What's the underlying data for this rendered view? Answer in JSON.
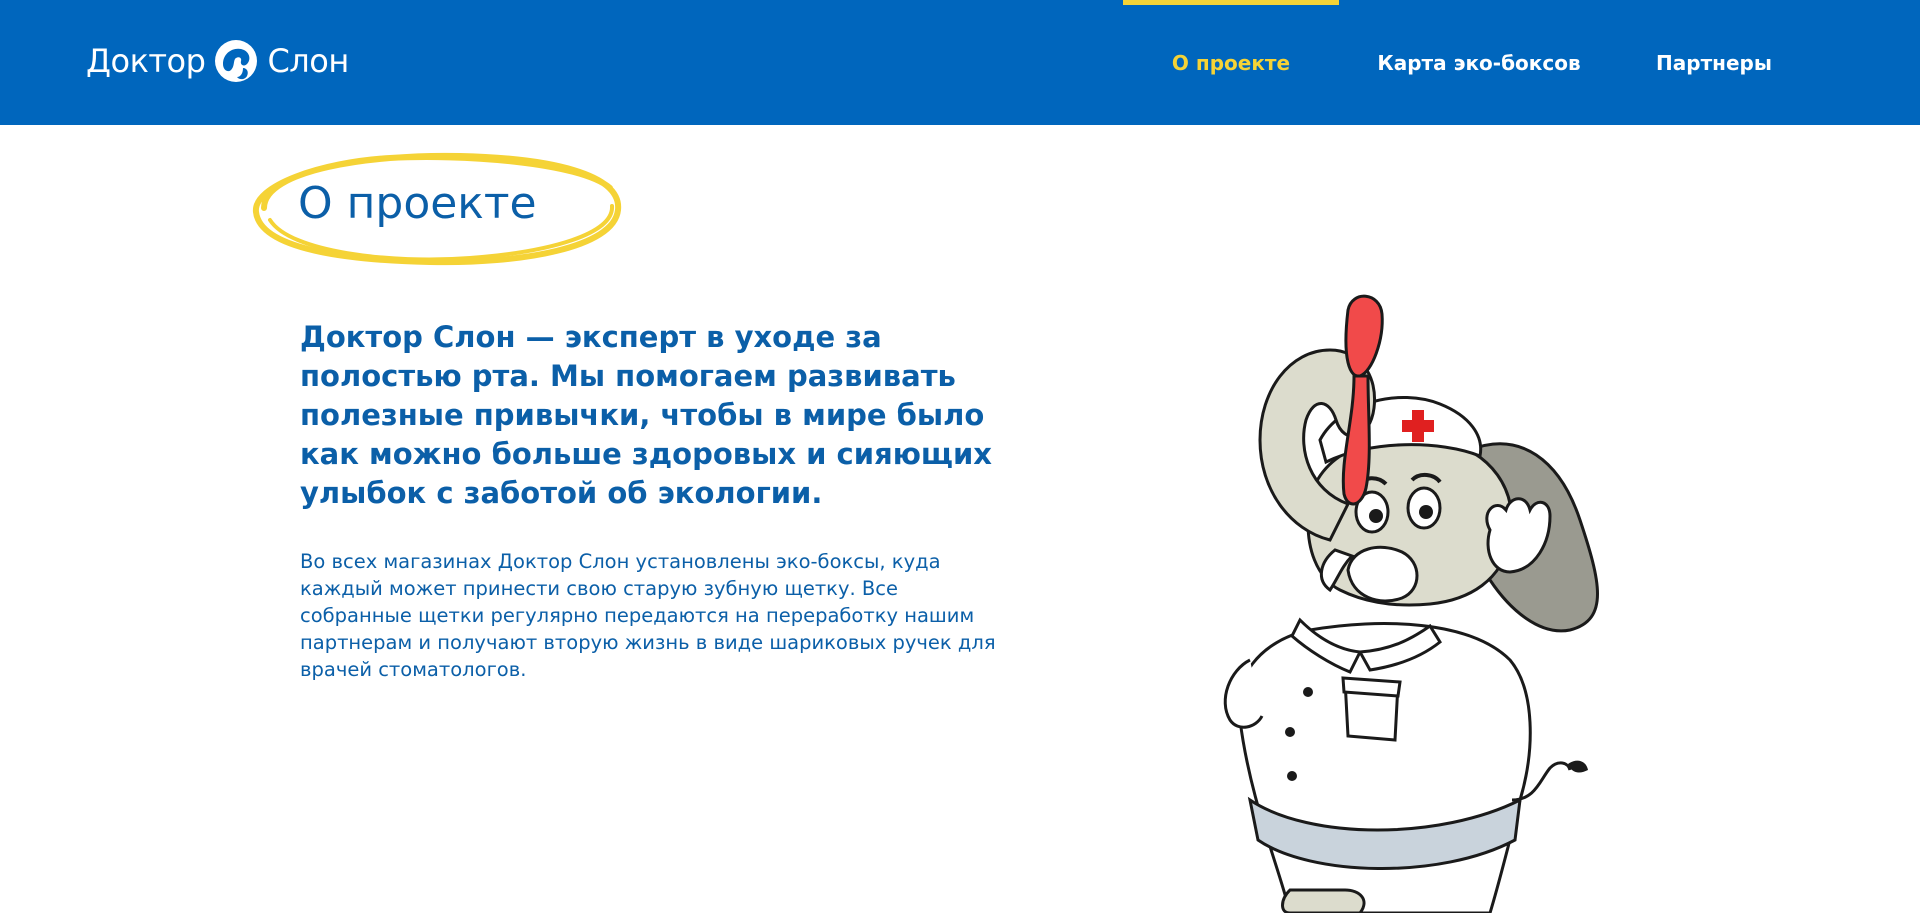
{
  "header": {
    "logo": {
      "left_text": "Доктор",
      "right_text": "Слон",
      "icon": "elephant-head-icon"
    },
    "nav": [
      {
        "label": "О проекте",
        "active": true
      },
      {
        "label": "Карта эко-боксов",
        "active": false
      },
      {
        "label": "Партнеры",
        "active": false
      }
    ]
  },
  "main": {
    "title": "О проекте",
    "lead": "Доктор Слон — эксперт в уходе за полостью рта. Мы помогаем развивать полезные привычки, чтобы в мире было как можно больше здоровых и сияющих улыбок с заботой об экологии.",
    "body": "Во всех магазинах Доктор Слон установлены эко-боксы, куда каждый может принести свою старую зубную щетку. Все собранные щетки регулярно передаются на переработку нашим партнерам и получают вторую жизнь в виде шариковых ручек для врачей стоматологов.",
    "illustration": "elephant-doctor-illustration"
  },
  "colors": {
    "brand_blue": "#0066bd",
    "text_blue": "#0b5fa8",
    "accent_yellow": "#f5d336",
    "white": "#ffffff"
  }
}
